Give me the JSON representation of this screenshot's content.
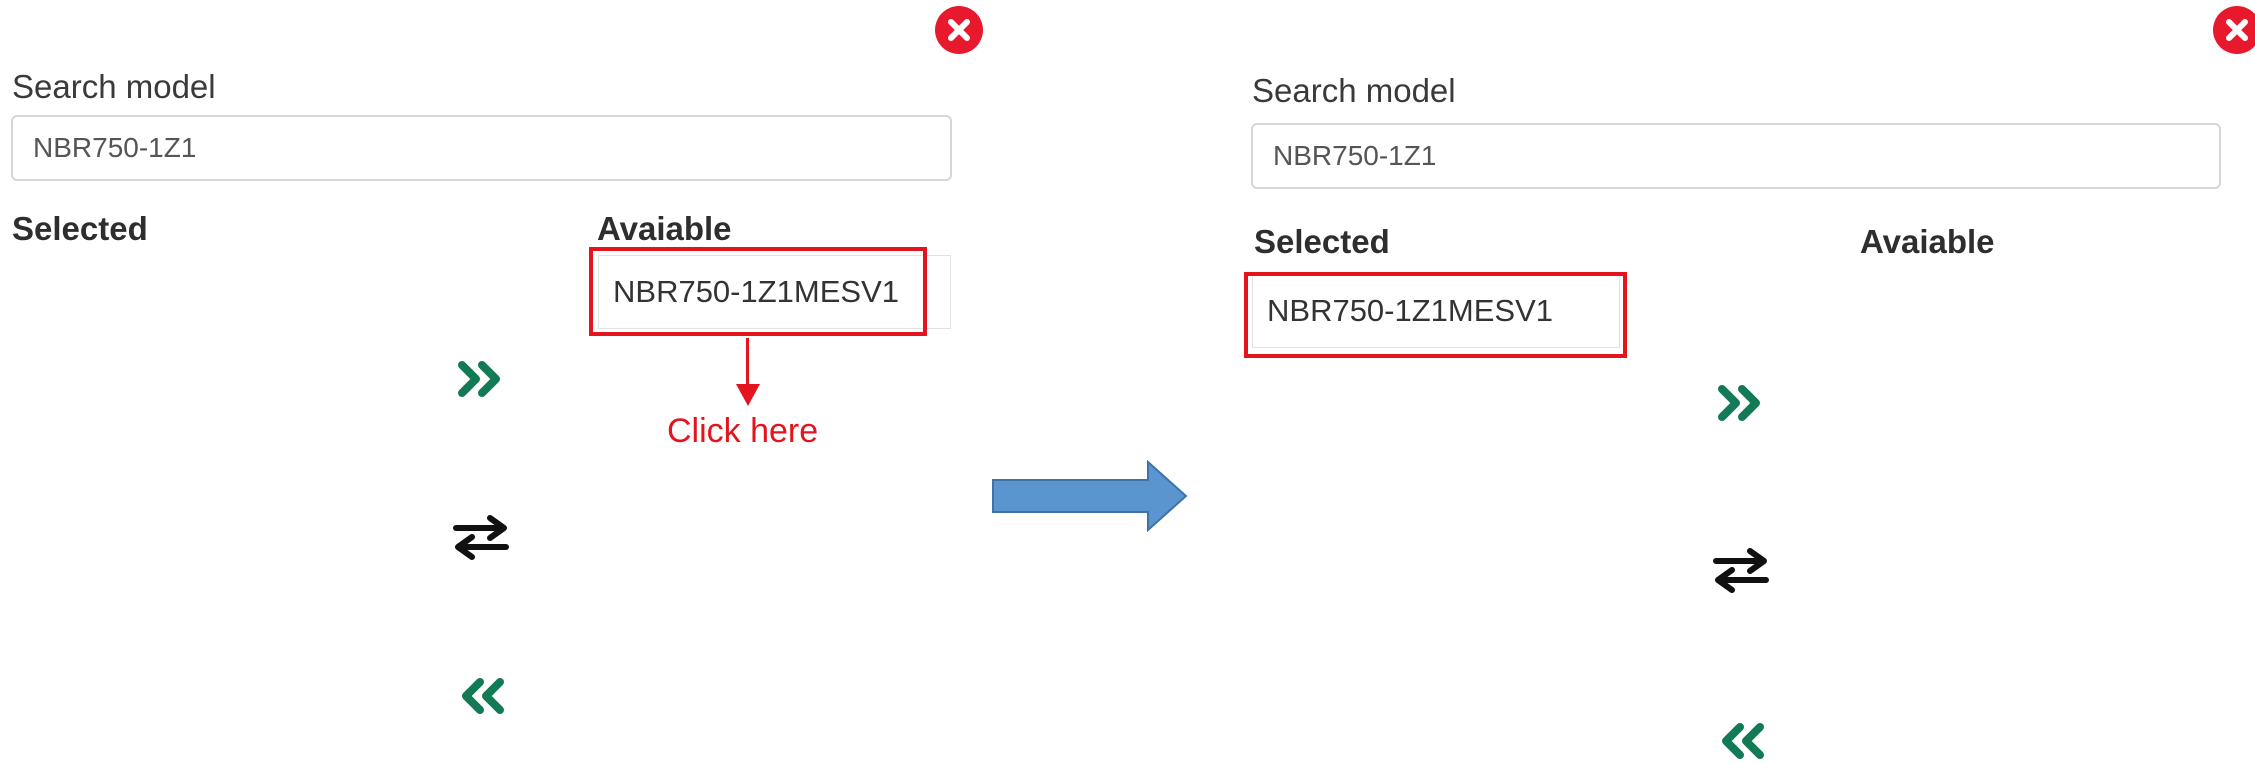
{
  "colors": {
    "close": "#e8192c",
    "accent_green": "#127a55",
    "swap_black": "#111111",
    "highlight_red": "#e3141d",
    "flow_arrow_fill": "#5a95d0",
    "flow_arrow_stroke": "#3f73a8"
  },
  "left_panel": {
    "close_icon": "close-circle-icon",
    "search_label": "Search model",
    "search_value": "NBR750-1Z1",
    "selected_heading": "Selected",
    "available_heading": "Avaiable",
    "available_items": [
      "NBR750-1Z1MESV1"
    ],
    "selected_items": [],
    "move_right_icon": "double-chevron-right-icon",
    "swap_icon": "swap-arrows-icon",
    "move_left_icon": "double-chevron-left-icon",
    "callout_text": "Click here"
  },
  "flow_arrow_icon": "arrow-right-icon",
  "right_panel": {
    "close_icon": "close-circle-icon",
    "search_label": "Search model",
    "search_value": "NBR750-1Z1",
    "selected_heading": "Selected",
    "available_heading": "Avaiable",
    "selected_items": [
      "NBR750-1Z1MESV1"
    ],
    "available_items": [],
    "move_right_icon": "double-chevron-right-icon",
    "swap_icon": "swap-arrows-icon",
    "move_left_icon": "double-chevron-left-icon"
  }
}
